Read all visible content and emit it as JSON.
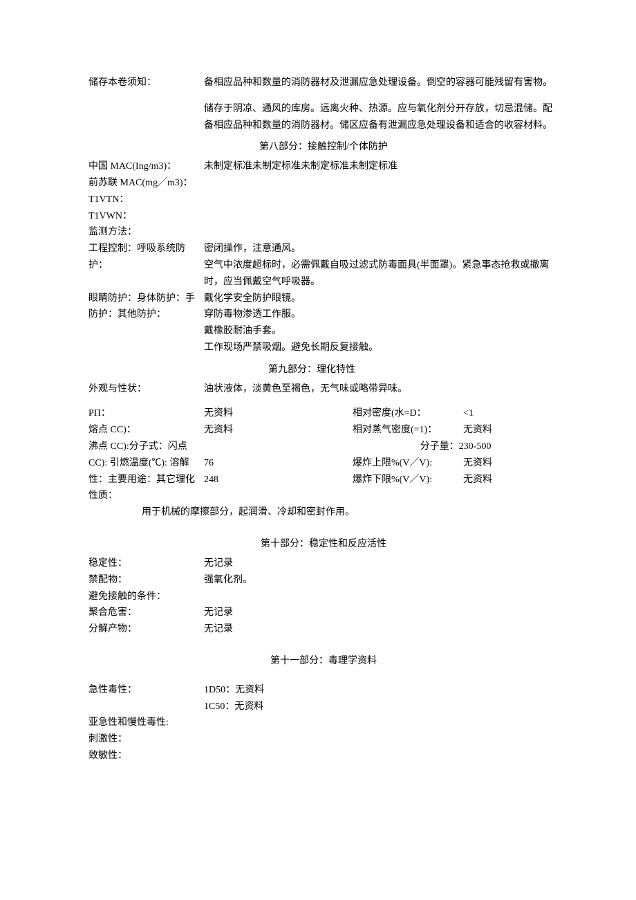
{
  "sec7": {
    "storage_label": "储存本卷须知：",
    "para1": "备相应品种和数量的消防器材及泄漏应急处理设备。倒空的容器可能残留有害物。",
    "para2": "储存于阴凉、通风的库房。远离火种、热源。应与氧化剂分开存放，切忌混储。配备相应品种和数量的消防器材。储区应备有泄漏应急处理设备和适合的收容材料。"
  },
  "sec8": {
    "title": "第八部分：接触控制/个体防护",
    "label1": "中国 MAC(Ing/m3)：",
    "value1": "未制定标准未制定标准未制定标准未制定标准",
    "label2": "前苏联 MAC(mg／m3)：",
    "label3": "T1VTN：",
    "label4": "T1VWN：",
    "label5": "监测方法：",
    "label6a": "工程控制：呼吸系统防护：",
    "value6a": "密闭操作，注意通风。",
    "value6b": "空气中浓度超标时，必需佩戴自吸过滤式防毒面具(半面罩)。紧急事态抢救或撤离时，应当佩戴空气呼吸器。",
    "label7": "眼睛防护：身体防护：手防护：其他防护：",
    "value7a": "戴化学安全防护眼镜。",
    "value7b": "穿防毒物渗透工作服。",
    "value7c": "戴橡胶耐油手套。",
    "value7d": "工作现场严禁吸烟。避免长期反复接触。"
  },
  "sec9": {
    "title": "第九部分：理化特性",
    "appear_label": "外观与性状：",
    "appear_value": "油状液体，淡黄色至褐色，无气味或略带异味。",
    "r1l": "PΠ：",
    "r1v1": "无资料",
    "r1l2": "相对密度(水=D：",
    "r1v2": "<1",
    "r2l": "熔点 CC)：",
    "r2v1": "无资料",
    "r2l2": "相对蒸气密度(=1)：",
    "r2v2": "无资料",
    "r3l": "沸点 CC):分子式：闪点 CC):",
    "r3l2": "分子量：230-500",
    "r4v1": "76",
    "r4l2": "爆炸上限%(V／V):",
    "r4v2": "无资料",
    "r5l": "引燃温度(℃):",
    "r5v1": "248",
    "r5l2": "爆炸下限%(V／V):",
    "r5v2": "无资料",
    "r6l": "溶解性：主要用途：其它理化性质：",
    "r6v": "用于机械的摩擦部分，起润滑、冷却和密封作用。"
  },
  "sec10": {
    "title": "第十部分：稳定性和反应活性",
    "l1": "稳定性：",
    "v1": "无记录",
    "l2": "禁配物：",
    "v2": "强氧化剂。",
    "l3": "避免接触的条件：",
    "l4": "聚合危害：",
    "v4": "无记录",
    "l5": "分解产物：",
    "v5": "无记录"
  },
  "sec11": {
    "title": "第十一部分：毒理学资料",
    "l1": "急性毒性：",
    "v1a": "1D50：无资料",
    "v1b": "1C50：无资料",
    "l2": "亚急性和慢性毒性:",
    "l3": "刺激性：",
    "l4": "致敏性："
  }
}
